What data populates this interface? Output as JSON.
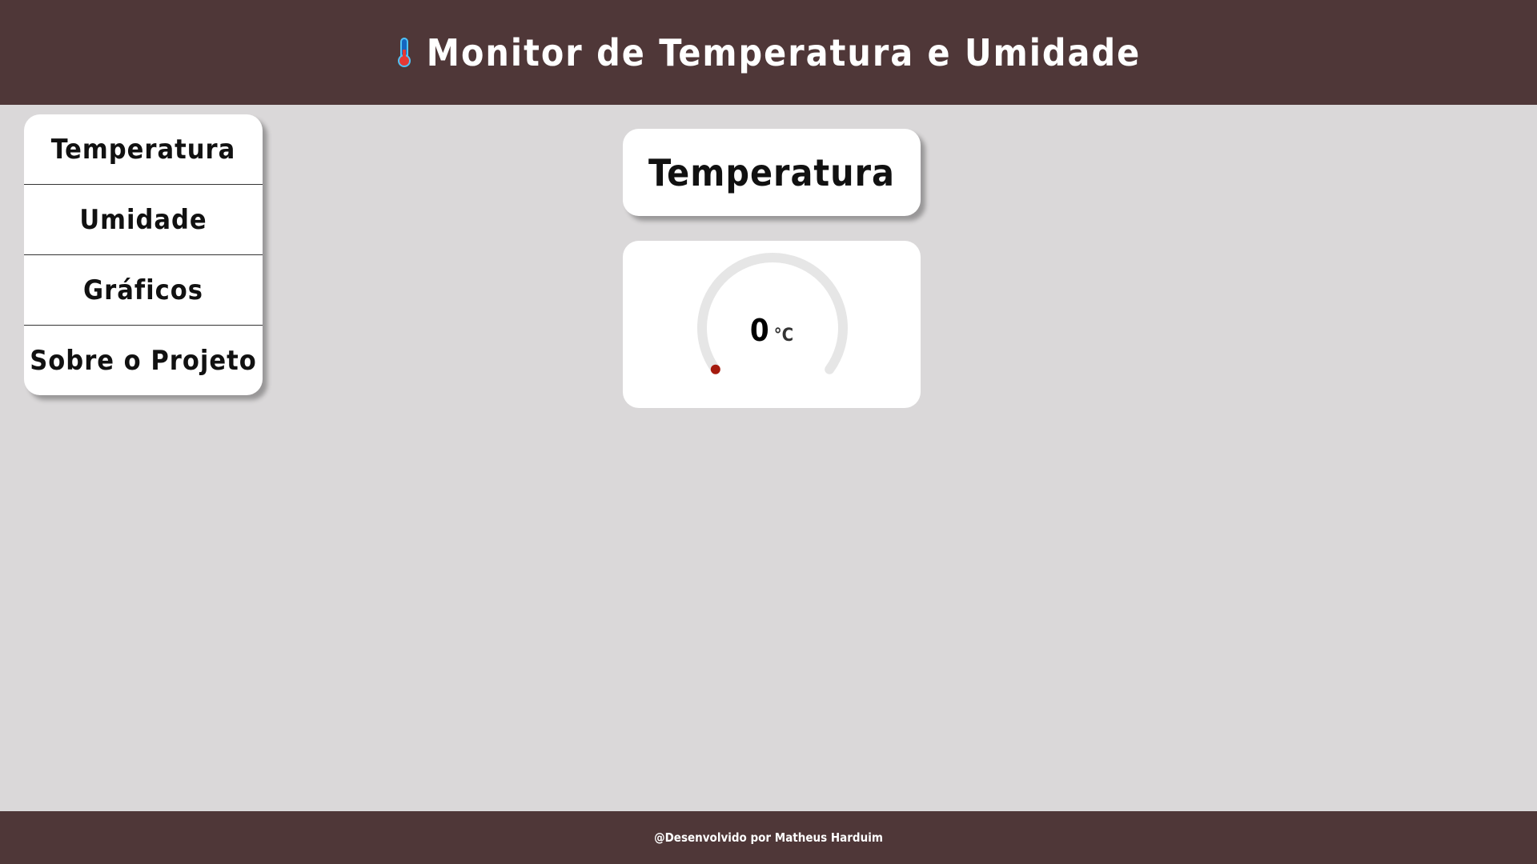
{
  "header": {
    "title": "Monitor de Temperatura e Umidade",
    "icon": "thermometer-icon"
  },
  "sidebar": {
    "items": [
      {
        "label": "Temperatura"
      },
      {
        "label": "Umidade"
      },
      {
        "label": "Gráficos"
      },
      {
        "label": "Sobre o Projeto"
      }
    ]
  },
  "main": {
    "title": "Temperatura",
    "gauge": {
      "value": "0",
      "unit": "°C",
      "fraction": 0,
      "track_color": "#e6e6e6",
      "indicator_color": "#a51a0e"
    }
  },
  "footer": {
    "text": "@Desenvolvido por Matheus Harduim"
  }
}
